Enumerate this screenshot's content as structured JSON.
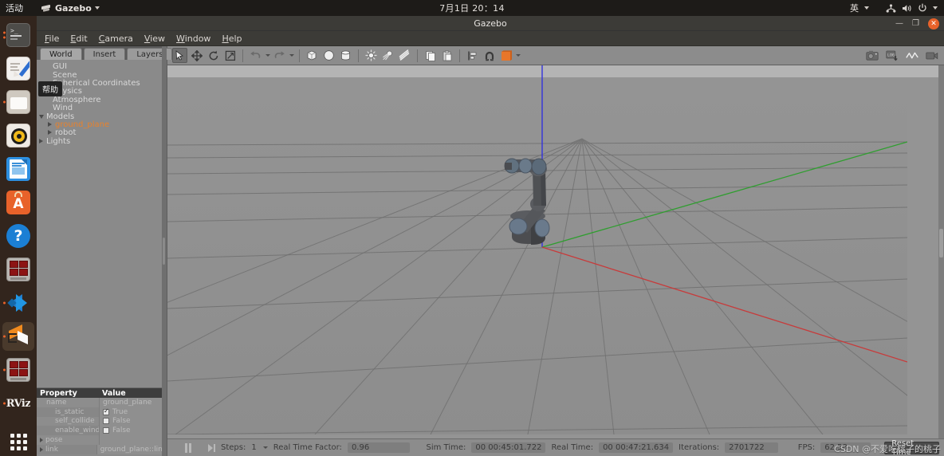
{
  "desktop": {
    "activities_label": "活动",
    "app_menu_label": "Gazebo",
    "clock": "7月1日 20：14",
    "input_method": "英",
    "tray_icons": [
      "network-icon",
      "volume-icon",
      "power-icon"
    ]
  },
  "dock": {
    "items": [
      {
        "name": "terminal",
        "running_dots": 2
      },
      {
        "name": "text-editor",
        "running_dots": 0
      },
      {
        "name": "files",
        "running_dots": 1
      },
      {
        "name": "rhythmbox",
        "running_dots": 0
      },
      {
        "name": "libreoffice-impress",
        "running_dots": 0
      },
      {
        "name": "ubuntu-software",
        "running_dots": 0
      },
      {
        "name": "help",
        "running_dots": 0
      },
      {
        "name": "terminator",
        "running_dots": 0
      },
      {
        "name": "vscode",
        "running_dots": 1
      },
      {
        "name": "gazebo",
        "running_dots": 1,
        "active": true
      },
      {
        "name": "terminator-2",
        "running_dots": 1
      },
      {
        "name": "rviz",
        "running_dots": 1,
        "label": "RViz"
      },
      {
        "name": "show-applications",
        "running_dots": 0
      }
    ]
  },
  "window": {
    "title": "Gazebo",
    "controls": {
      "minimize": "—",
      "maximize": "❐",
      "close": "✕"
    },
    "menu": [
      {
        "label": "File",
        "mnemonic": "F"
      },
      {
        "label": "Edit",
        "mnemonic": "E"
      },
      {
        "label": "Camera",
        "mnemonic": "C"
      },
      {
        "label": "View",
        "mnemonic": "V"
      },
      {
        "label": "Window",
        "mnemonic": "W"
      },
      {
        "label": "Help",
        "mnemonic": "H"
      }
    ]
  },
  "left_panel": {
    "tabs": [
      {
        "label": "World",
        "selected": true
      },
      {
        "label": "Insert",
        "selected": false
      },
      {
        "label": "Layers",
        "selected": false
      }
    ],
    "tree": [
      {
        "label": "GUI",
        "level": 0,
        "arrow": "none",
        "selected": false
      },
      {
        "label": "Scene",
        "level": 0,
        "arrow": "none",
        "selected": false
      },
      {
        "label": "Spherical Coordinates",
        "level": 0,
        "arrow": "none",
        "selected": false
      },
      {
        "label": "Physics",
        "level": 0,
        "arrow": "none",
        "selected": false
      },
      {
        "label": "Atmosphere",
        "level": 0,
        "arrow": "none",
        "selected": false
      },
      {
        "label": "Wind",
        "level": 0,
        "arrow": "none",
        "selected": false
      },
      {
        "label": "Models",
        "level": 0,
        "arrow": "open",
        "selected": false
      },
      {
        "label": "ground_plane",
        "level": 1,
        "arrow": "closed",
        "selected": true
      },
      {
        "label": "robot",
        "level": 1,
        "arrow": "closed",
        "selected": false
      },
      {
        "label": "Lights",
        "level": 0,
        "arrow": "closed",
        "selected": false
      }
    ],
    "property_table": {
      "headers": {
        "property": "Property",
        "value": "Value"
      },
      "rows": [
        {
          "property": "name",
          "value": "ground_plane",
          "type": "text",
          "arrow": false
        },
        {
          "property": "is_static",
          "value": "True",
          "type": "checkbox",
          "checked": true,
          "arrow": false
        },
        {
          "property": "self_collide",
          "value": "False",
          "type": "checkbox",
          "checked": false,
          "arrow": false
        },
        {
          "property": "enable_wind",
          "value": "False",
          "type": "checkbox",
          "checked": false,
          "arrow": false
        },
        {
          "property": "pose",
          "value": "",
          "type": "text",
          "arrow": true
        },
        {
          "property": "link",
          "value": "ground_plane::link",
          "type": "text",
          "arrow": true
        }
      ]
    },
    "tooltip": "帮助"
  },
  "toolbar": {
    "left_tools": [
      {
        "name": "select-mode-button",
        "icon": "arrow-cursor-icon",
        "pressed": true
      },
      {
        "name": "translate-mode-button",
        "icon": "move-arrows-icon",
        "pressed": false
      },
      {
        "name": "rotate-mode-button",
        "icon": "rotate-icon",
        "pressed": false
      },
      {
        "name": "scale-mode-button",
        "icon": "scale-icon",
        "pressed": false
      }
    ],
    "history_tools": [
      {
        "name": "undo-button",
        "icon": "undo-arrow-icon",
        "has_dropdown": true
      },
      {
        "name": "redo-button",
        "icon": "redo-arrow-icon",
        "has_dropdown": true
      }
    ],
    "shape_tools": [
      {
        "name": "insert-box-button",
        "icon": "box-icon"
      },
      {
        "name": "insert-sphere-button",
        "icon": "sphere-icon"
      },
      {
        "name": "insert-cylinder-button",
        "icon": "cylinder-icon"
      }
    ],
    "light_tools": [
      {
        "name": "point-light-button",
        "icon": "point-light-icon"
      },
      {
        "name": "spot-light-button",
        "icon": "spot-light-icon"
      },
      {
        "name": "directional-light-button",
        "icon": "directional-light-icon"
      }
    ],
    "clipboard_tools": [
      {
        "name": "copy-button",
        "icon": "copy-icon"
      },
      {
        "name": "paste-button",
        "icon": "paste-icon"
      }
    ],
    "align_tools": [
      {
        "name": "align-button",
        "icon": "align-icon"
      },
      {
        "name": "snap-button",
        "icon": "magnet-icon"
      },
      {
        "name": "view-angle-button",
        "icon": "orange-cube-icon",
        "has_dropdown": true
      }
    ],
    "right_tools": [
      {
        "name": "screenshot-button",
        "icon": "camera-icon"
      },
      {
        "name": "log-data-button",
        "icon": "log-record-icon"
      },
      {
        "name": "plot-button",
        "icon": "line-chart-icon"
      },
      {
        "name": "record-video-button",
        "icon": "video-camera-icon"
      }
    ]
  },
  "viewport": {
    "scene": "3d-scene",
    "models": [
      "ground_plane",
      "robot"
    ],
    "axes": {
      "x_color": "#cc3333",
      "y_color": "#33aa33",
      "z_color": "#3333dd"
    }
  },
  "statusbar": {
    "pause_button": "pause-icon",
    "step_button": "step-forward-icon",
    "steps_label": "Steps:",
    "steps_value": "1",
    "rtf_label": "Real Time Factor:",
    "rtf_value": "0.96",
    "simtime_label": "Sim Time:",
    "simtime_value": "00 00:45:01.722",
    "realtime_label": "Real Time:",
    "realtime_value": "00 00:47:21.634",
    "iterations_label": "Iterations:",
    "iterations_value": "2701722",
    "fps_label": "FPS:",
    "fps_value": "62.58",
    "reset_button": "Reset Time"
  },
  "watermark": "CSDN @不爱吃桃子的桃子",
  "colors": {
    "accent_orange": "#e8622a",
    "selected_tree_item": "#e8822c",
    "panel_gray": "#8a8a8a",
    "dock_brown": "#32251d"
  }
}
